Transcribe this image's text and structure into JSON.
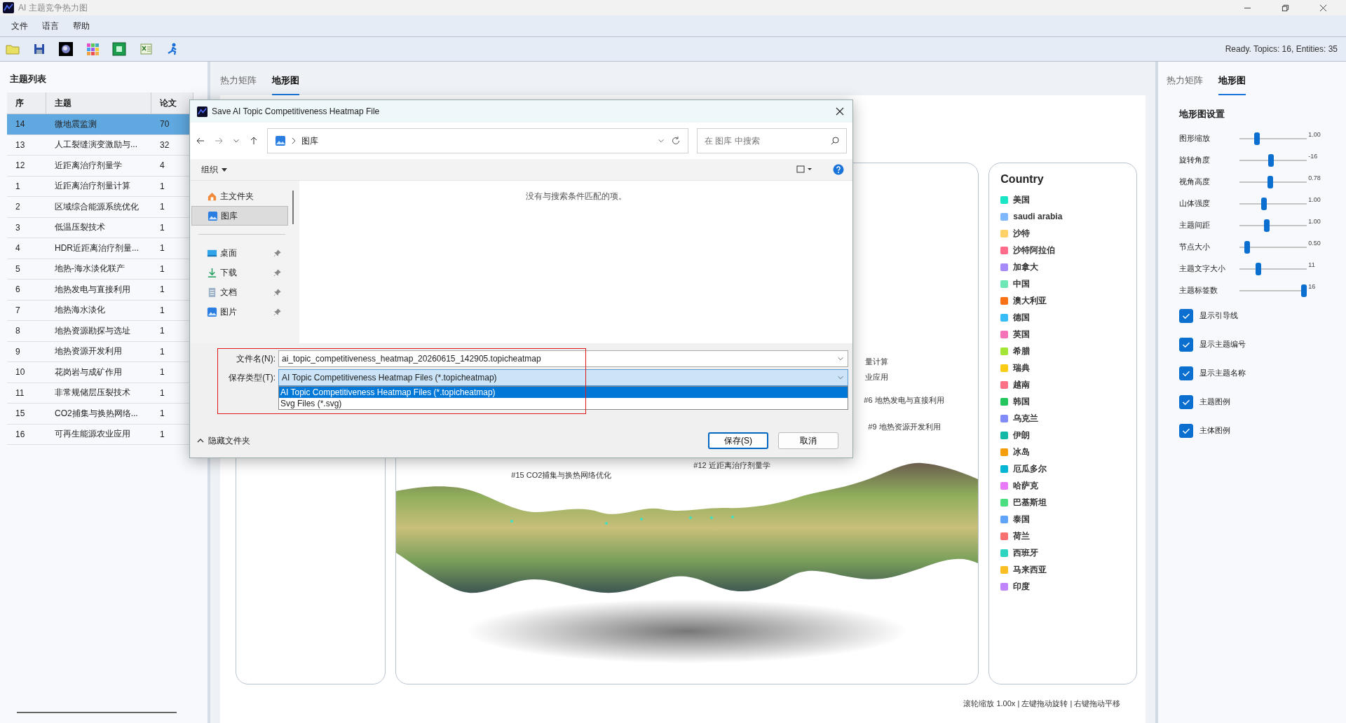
{
  "window": {
    "title": "AI 主题竞争热力图"
  },
  "menu": [
    "文件",
    "语言",
    "帮助"
  ],
  "status": "Ready. Topics: 16, Entities: 35",
  "topic_panel": {
    "title": "主题列表",
    "columns": [
      "序",
      "主题",
      "论文"
    ],
    "rows": [
      {
        "id": "14",
        "topic": "微地震监测",
        "papers": "70",
        "selected": true
      },
      {
        "id": "13",
        "topic": "人工裂缝演变激励与...",
        "papers": "32",
        "selected": false
      },
      {
        "id": "12",
        "topic": "近距离治疗剂量学",
        "papers": "4",
        "selected": false
      },
      {
        "id": "1",
        "topic": "近距离治疗剂量计算",
        "papers": "1",
        "selected": false
      },
      {
        "id": "2",
        "topic": "区域综合能源系统优化",
        "papers": "1",
        "selected": false
      },
      {
        "id": "3",
        "topic": "低温压裂技术",
        "papers": "1",
        "selected": false
      },
      {
        "id": "4",
        "topic": "HDR近距离治疗剂量...",
        "papers": "1",
        "selected": false
      },
      {
        "id": "5",
        "topic": "地热-海水淡化联产",
        "papers": "1",
        "selected": false
      },
      {
        "id": "6",
        "topic": "地热发电与直接利用",
        "papers": "1",
        "selected": false
      },
      {
        "id": "7",
        "topic": "地热海水淡化",
        "papers": "1",
        "selected": false
      },
      {
        "id": "8",
        "topic": "地热资源勘探与选址",
        "papers": "1",
        "selected": false
      },
      {
        "id": "9",
        "topic": "地热资源开发利用",
        "papers": "1",
        "selected": false
      },
      {
        "id": "10",
        "topic": "花岗岩与成矿作用",
        "papers": "1",
        "selected": false
      },
      {
        "id": "11",
        "topic": "非常规储层压裂技术",
        "papers": "1",
        "selected": false
      },
      {
        "id": "15",
        "topic": "CO2捕集与换热网络...",
        "papers": "1",
        "selected": false
      },
      {
        "id": "16",
        "topic": "可再生能源农业应用",
        "papers": "1",
        "selected": false
      }
    ]
  },
  "center_tabs": [
    {
      "label": "热力矩阵",
      "selected": false
    },
    {
      "label": "地形图",
      "selected": true
    }
  ],
  "terrain_labels": [
    "量计算",
    "业应用",
    "#6 地热发电与直接利用",
    "#9 地热资源开发利用",
    "#12 近距离治疗剂量学",
    "#15 CO2捕集与换热网络优化"
  ],
  "country_legend": {
    "title": "Country",
    "items": [
      {
        "label": "美国",
        "color": "#19e6c4"
      },
      {
        "label": "saudi arabia",
        "color": "#7fb8ff"
      },
      {
        "label": "沙特",
        "color": "#ffd166"
      },
      {
        "label": "沙特阿拉伯",
        "color": "#ff6b8b"
      },
      {
        "label": "加拿大",
        "color": "#a78bfa"
      },
      {
        "label": "中国",
        "color": "#6ee7b7"
      },
      {
        "label": "澳大利亚",
        "color": "#f97316"
      },
      {
        "label": "德国",
        "color": "#38bdf8"
      },
      {
        "label": "英国",
        "color": "#f472b6"
      },
      {
        "label": "希腊",
        "color": "#a3e635"
      },
      {
        "label": "瑞典",
        "color": "#facc15"
      },
      {
        "label": "越南",
        "color": "#fb7185"
      },
      {
        "label": "韩国",
        "color": "#22c55e"
      },
      {
        "label": "乌克兰",
        "color": "#818cf8"
      },
      {
        "label": "伊朗",
        "color": "#14b8a6"
      },
      {
        "label": "冰岛",
        "color": "#f59e0b"
      },
      {
        "label": "厄瓜多尔",
        "color": "#06b6d4"
      },
      {
        "label": "哈萨克",
        "color": "#e879f9"
      },
      {
        "label": "巴基斯坦",
        "color": "#4ade80"
      },
      {
        "label": "泰国",
        "color": "#60a5fa"
      },
      {
        "label": "荷兰",
        "color": "#f87171"
      },
      {
        "label": "西班牙",
        "color": "#2dd4bf"
      },
      {
        "label": "马来西亚",
        "color": "#fbbf24"
      },
      {
        "label": "印度",
        "color": "#c084fc"
      }
    ]
  },
  "hint": "滚轮缩放 1.00x | 左键拖动旋转 | 右键拖动平移",
  "settings_tabs": [
    {
      "label": "热力矩阵",
      "selected": false
    },
    {
      "label": "地形图",
      "selected": true
    }
  ],
  "settings": {
    "title": "地形图设置",
    "sliders": [
      {
        "label": "图形缩放",
        "level": 0.23,
        "reading": "1.00"
      },
      {
        "label": "旋转角度",
        "level": 0.46,
        "reading": "-16"
      },
      {
        "label": "视角高度",
        "level": 0.45,
        "reading": "0.78"
      },
      {
        "label": "山体强度",
        "level": 0.35,
        "reading": "1.00"
      },
      {
        "label": "主题间距",
        "level": 0.39,
        "reading": "1.00"
      },
      {
        "label": "节点大小",
        "level": 0.08,
        "reading": "0.50"
      },
      {
        "label": "主题文字大小",
        "level": 0.26,
        "reading": "11"
      },
      {
        "label": "主题标签数",
        "level": 1,
        "reading": "16"
      }
    ],
    "checkboxes": [
      {
        "label": "显示引导线",
        "checked": true
      },
      {
        "label": "显示主题编号",
        "checked": true
      },
      {
        "label": "显示主题名称",
        "checked": true
      },
      {
        "label": "主题图例",
        "checked": true
      },
      {
        "label": "主体图例",
        "checked": true
      }
    ]
  },
  "dialog": {
    "title": "Save AI Topic Competitiveness Heatmap File",
    "path": "图库",
    "search": {
      "placeholder": "在 图库 中搜索"
    },
    "organize": "组织",
    "nav": [
      {
        "label": "主文件夹",
        "kind": "home",
        "selected": false,
        "pinned": false
      },
      {
        "label": "图库",
        "kind": "gallery",
        "selected": true,
        "pinned": false
      },
      {
        "label": "桌面",
        "kind": "desktop",
        "selected": false,
        "pinned": true
      },
      {
        "label": "下载",
        "kind": "download",
        "selected": false,
        "pinned": true
      },
      {
        "label": "文档",
        "kind": "document",
        "selected": false,
        "pinned": true
      },
      {
        "label": "图片",
        "kind": "pictures",
        "selected": false,
        "pinned": true
      }
    ],
    "empty_message": "没有与搜索条件匹配的项。",
    "filename_label": "文件名(N):",
    "filename": "ai_topic_competitiveness_heatmap_20260615_142905.topicheatmap",
    "type_label": "保存类型(T):",
    "type_value": "AI Topic Competitiveness Heatmap Files (*.topicheatmap)",
    "type_options": [
      {
        "label": "AI Topic Competitiveness Heatmap Files (*.topicheatmap)",
        "selected": true
      },
      {
        "label": "Svg Files (*.svg)",
        "selected": false
      }
    ],
    "hide_folders": "隐藏文件夹",
    "buttons": [
      "保存(S)",
      "取消"
    ]
  }
}
